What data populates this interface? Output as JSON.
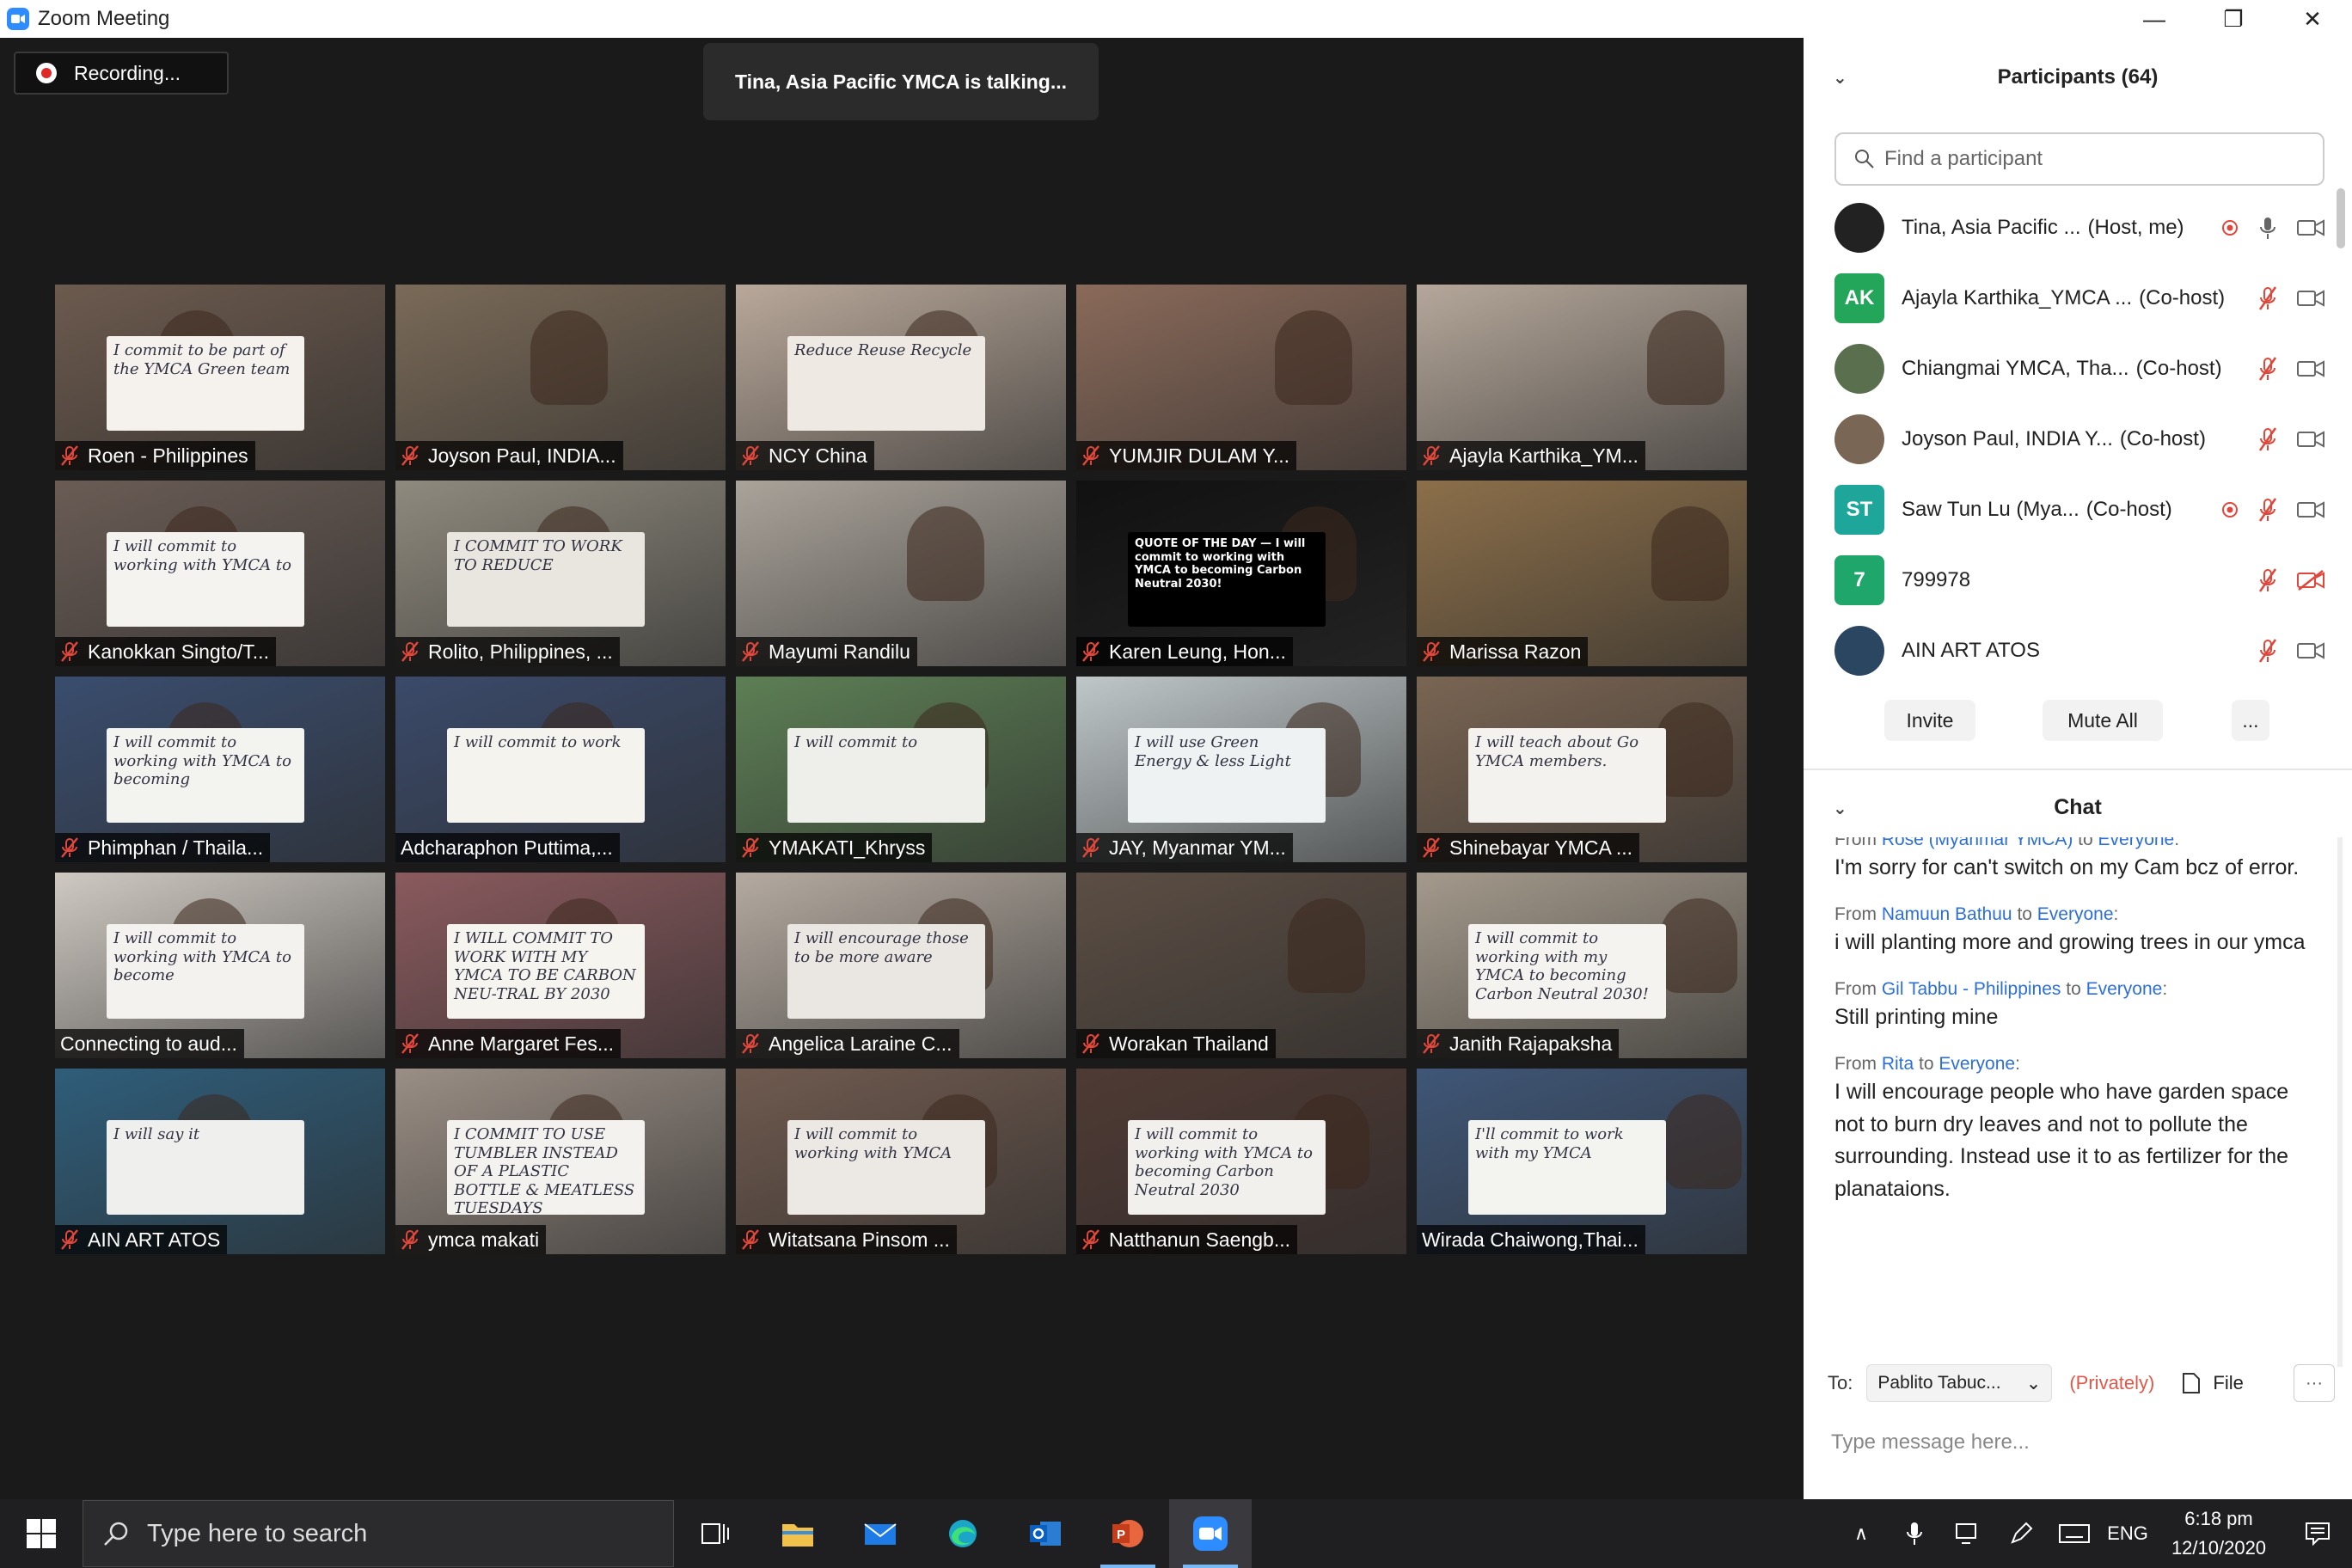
{
  "window": {
    "title": "Zoom Meeting",
    "minimize": "—",
    "maximize": "❐",
    "close": "✕"
  },
  "recording": {
    "label": "Recording..."
  },
  "talking": {
    "text": "Tina, Asia Pacific YMCA is talking..."
  },
  "tiles": [
    {
      "name": "Roen - Philippines",
      "muted": true,
      "bg": "#6c5a4e",
      "sign": "I commit to be part of the YMCA Green team",
      "sign_bg": "#f5f2ee"
    },
    {
      "name": "Joyson Paul, INDIA...",
      "muted": true,
      "bg": "#7a6a58",
      "sign": "",
      "sign_bg": "#f0f0ea"
    },
    {
      "name": "NCY China",
      "muted": true,
      "bg": "#b9a89a",
      "sign": "Reduce Reuse Recycle",
      "sign_bg": "#efe9e3"
    },
    {
      "name": "YUMJIR DULAM Y...",
      "muted": true,
      "bg": "#8a6a5a",
      "sign": "",
      "sign_bg": ""
    },
    {
      "name": "Ajayla Karthika_YM...",
      "muted": true,
      "bg": "#b5a79a",
      "sign": "",
      "sign_bg": ""
    },
    {
      "name": "Kanokkan Singto/T...",
      "muted": true,
      "bg": "#6a5c55",
      "sign": "I will commit to working with YMCA to",
      "sign_bg": "#f4f3ef"
    },
    {
      "name": "Rolito, Philippines, ...",
      "muted": true,
      "bg": "#8f8a7e",
      "sign": "I COMMIT TO WORK TO REDUCE",
      "sign_bg": "#e8e6de"
    },
    {
      "name": "Mayumi Randilu",
      "muted": true,
      "bg": "#aaa39a",
      "sign": "",
      "sign_bg": "#e2ddd5"
    },
    {
      "name": "Karen Leung, Hon...",
      "muted": true,
      "bg": "#111111",
      "sign": "QUOTE OF THE DAY — I will commit to working with YMCA to becoming Carbon Neutral 2030!",
      "sign_bg": "#000000"
    },
    {
      "name": "Marissa Razon",
      "muted": true,
      "bg": "#8c6f4a",
      "sign": "",
      "sign_bg": "#eef1f4"
    },
    {
      "name": "Phimphan / Thaila...",
      "muted": true,
      "bg": "#3a4d6e",
      "sign": "I will commit to working with YMCA to becoming",
      "sign_bg": "#f3f3f0"
    },
    {
      "name": "Adcharaphon Puttima,...",
      "muted": false,
      "bg": "#3b4a6a",
      "sign": "I will commit to work",
      "sign_bg": "#f4f3ee"
    },
    {
      "name": "YMAKATI_Khryss",
      "muted": true,
      "bg": "#5d7f55",
      "sign": "I will commit to",
      "sign_bg": "#eeeeea"
    },
    {
      "name": "JAY, Myanmar YM...",
      "muted": true,
      "bg": "#bfc7c9",
      "sign": "I will use Green Energy & less Light",
      "sign_bg": "#eef2f3"
    },
    {
      "name": "Shinebayar YMCA ...",
      "muted": true,
      "bg": "#7a6553",
      "sign": "I will teach about Go YMCA members.",
      "sign_bg": "#f3f2ee"
    },
    {
      "name": "Connecting to aud...",
      "muted": false,
      "bg": "#cfc9c2",
      "sign": "I will commit to working with YMCA to become",
      "sign_bg": "#f4f2ee"
    },
    {
      "name": "Anne Margaret Fes...",
      "muted": true,
      "bg": "#8a5a5e",
      "sign": "I WILL COMMIT TO WORK WITH MY YMCA TO BE CARBON NEU-TRAL BY 2030",
      "sign_bg": "#f5f4ef"
    },
    {
      "name": "Angelica Laraine C...",
      "muted": true,
      "bg": "#b4aaa0",
      "sign": "I will encourage those to be more aware",
      "sign_bg": "#eae6e1"
    },
    {
      "name": "Worakan Thailand",
      "muted": true,
      "bg": "#5c4e44",
      "sign": "",
      "sign_bg": "#f1efeb"
    },
    {
      "name": "Janith Rajapaksha",
      "muted": true,
      "bg": "#a49a8c",
      "sign": "I will commit to working with my YMCA to becoming Carbon Neutral 2030!",
      "sign_bg": "#f4f3ef"
    },
    {
      "name": "AIN ART ATOS",
      "muted": true,
      "bg": "#2f5d7a",
      "sign": "I will say it",
      "sign_bg": "#efefee"
    },
    {
      "name": "ymca makati",
      "muted": true,
      "bg": "#9a8e85",
      "sign": "I COMMIT TO USE TUMBLER INSTEAD OF A PLASTIC BOTTLE & MEATLESS TUESDAYS",
      "sign_bg": "#f3f2ee"
    },
    {
      "name": "Witatsana Pinsom ...",
      "muted": true,
      "bg": "#6f5a4f",
      "sign": "I will commit to working with YMCA",
      "sign_bg": "#ece9e4"
    },
    {
      "name": "Natthanun Saengb...",
      "muted": true,
      "bg": "#4f3a34",
      "sign": "I will commit to working with YMCA to becoming Carbon Neutral 2030",
      "sign_bg": "#f1f0ec"
    },
    {
      "name": "Wirada Chaiwong,Thai...",
      "muted": false,
      "bg": "#3f5677",
      "sign": "I'll commit to work with my YMCA",
      "sign_bg": "#f3f4ef"
    }
  ],
  "participants": {
    "header": "Participants (64)",
    "search_placeholder": "Find a participant",
    "list": [
      {
        "initials": "",
        "name": "Tina, Asia Pacific ...",
        "role": "(Host, me)",
        "avatar_color": "#222222",
        "recording": true,
        "mic_muted": false,
        "video_off": false
      },
      {
        "initials": "AK",
        "name": "Ajayla Karthika_YMCA ...",
        "role": "(Co-host)",
        "avatar_color": "#23a55a",
        "recording": false,
        "mic_muted": true,
        "video_off": false
      },
      {
        "initials": "",
        "name": "Chiangmai YMCA, Tha...",
        "role": "(Co-host)",
        "avatar_color": "#5a6f4e",
        "recording": false,
        "mic_muted": true,
        "video_off": false
      },
      {
        "initials": "",
        "name": "Joyson Paul, INDIA Y...",
        "role": "(Co-host)",
        "avatar_color": "#7a6654",
        "recording": false,
        "mic_muted": true,
        "video_off": false
      },
      {
        "initials": "ST",
        "name": "Saw Tun Lu (Mya...",
        "role": "(Co-host)",
        "avatar_color": "#1fa69a",
        "recording": true,
        "mic_muted": true,
        "video_off": false
      },
      {
        "initials": "7",
        "name": "799978",
        "role": "",
        "avatar_color": "#1fa66a",
        "recording": false,
        "mic_muted": true,
        "video_off": true
      },
      {
        "initials": "",
        "name": "AIN ART ATOS",
        "role": "",
        "avatar_color": "#2b4660",
        "recording": false,
        "mic_muted": true,
        "video_off": false
      }
    ],
    "invite": "Invite",
    "mute_all": "Mute All",
    "more": "..."
  },
  "chat": {
    "header": "Chat",
    "messages": [
      {
        "from_label": "From ",
        "sender": "Rose (Myanmar YMCA)",
        "to_label": " to ",
        "recipient": "Everyone",
        "text": "I'm sorry for can't switch on my Cam bcz of error."
      },
      {
        "from_label": "From ",
        "sender": "Namuun Bathuu",
        "to_label": " to ",
        "recipient": "Everyone",
        "text": "i will planting more and growing trees in our ymca"
      },
      {
        "from_label": "From ",
        "sender": "Gil Tabbu - Philippines",
        "to_label": " to ",
        "recipient": "Everyone",
        "text": "Still printing mine"
      },
      {
        "from_label": "From ",
        "sender": "Rita",
        "to_label": " to ",
        "recipient": "Everyone",
        "text": "I will encourage people who have garden space not to burn dry leaves and not to pollute the surrounding. Instead use it to as fertilizer for the planataions."
      }
    ],
    "to_label": "To:",
    "to_value": "Pablito Tabuc...",
    "privately": "(Privately)",
    "file": "File",
    "more": "···",
    "placeholder": "Type message here..."
  },
  "taskbar": {
    "search_placeholder": "Type here to search",
    "lang": "ENG",
    "time": "6:18 pm",
    "date": "12/10/2020"
  },
  "colors": {
    "accent": "#2d8cff",
    "muted_red": "#e0463a",
    "link": "#2d6fd6"
  }
}
